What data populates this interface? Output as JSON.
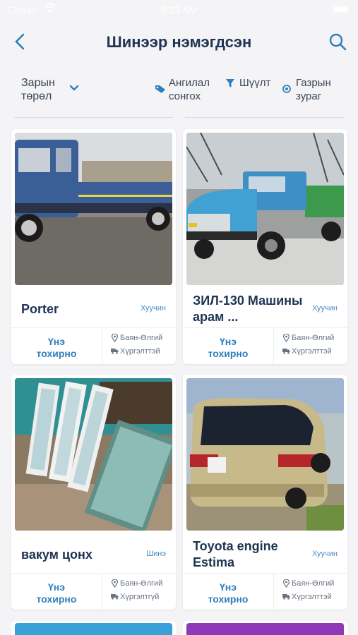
{
  "status": {
    "carrier": "Carrier",
    "time": "8:23 AM"
  },
  "nav": {
    "title": "Шинээр нэмэгдсэн",
    "back_icon": "chevron-left-icon",
    "search_icon": "search-icon"
  },
  "filters": {
    "type": {
      "line1": "Зарын",
      "line2": "төрөл"
    },
    "category": {
      "line1": "Ангилал",
      "line2": "сонгох"
    },
    "filter": {
      "label": "Шүүлт"
    },
    "map": {
      "line1": "Газрын",
      "line2": "зураг"
    }
  },
  "colors": {
    "accent": "#2e7fbd",
    "title": "#1f3352",
    "background": "#f4f4f6"
  },
  "listings": [
    {
      "name": "Porter",
      "condition": "Хуучин",
      "price_line1": "Үнэ",
      "price_line2": "тохирно",
      "location": "Баян-Өлгий",
      "delivery": "Хүргэлттэй"
    },
    {
      "name": "ЗИЛ-130 Машины арам ...",
      "condition": "Хуучин",
      "price_line1": "Үнэ",
      "price_line2": "тохирно",
      "location": "Баян-Өлгий",
      "delivery": "Хүргэлттэй"
    },
    {
      "name": "вакум цонх",
      "condition": "Шинэ",
      "price_line1": "Үнэ",
      "price_line2": "тохирно",
      "location": "Баян-Өлгий",
      "delivery": "Хүргэлтгүй"
    },
    {
      "name": "Toyota engine Estima",
      "condition": "Хуучин",
      "price_line1": "Үнэ",
      "price_line2": "тохирно",
      "location": "Баян-Өлгий",
      "delivery": "Хүргэлттэй"
    }
  ]
}
